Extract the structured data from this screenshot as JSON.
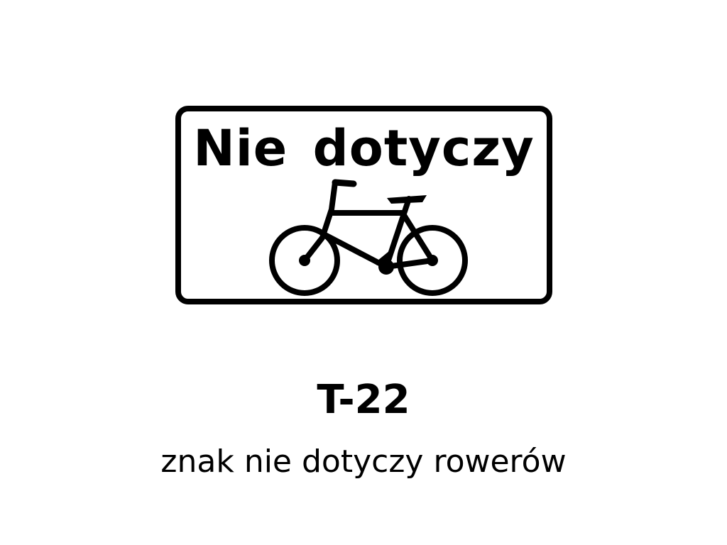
{
  "sign": {
    "text": "Nie dotyczy",
    "symbol": "bicycle-icon",
    "colors": {
      "foreground": "#000000",
      "background": "#ffffff"
    }
  },
  "caption": {
    "code": "T-22",
    "description": "znak nie dotyczy rowerów"
  }
}
